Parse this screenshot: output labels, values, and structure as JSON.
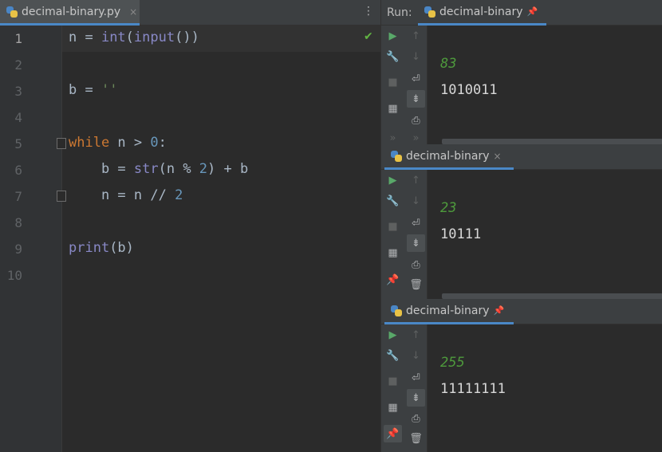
{
  "editor": {
    "tab_label": "decimal-binary.py",
    "tab_close": "×",
    "menu_icon": "⋮",
    "line_numbers": [
      "1",
      "2",
      "3",
      "4",
      "5",
      "6",
      "7",
      "8",
      "9",
      "10"
    ]
  },
  "run_panel": {
    "run_label": "Run:",
    "sessions": [
      {
        "tab_label": "decimal-binary",
        "tab_icon": "pin",
        "input": "83",
        "output": "1010011"
      },
      {
        "tab_label": "decimal-binary",
        "tab_icon": "close",
        "input": "23",
        "output": "10111"
      },
      {
        "tab_label": "decimal-binary",
        "tab_icon": "pin",
        "input": "255",
        "output": "11111111"
      }
    ]
  },
  "colors": {
    "keyword": "#cc7832",
    "builtin": "#8888c6",
    "number": "#6897bb",
    "string": "#6a8759",
    "console_input": "#4e9a3c",
    "tab_underline": "#4a88c7"
  }
}
